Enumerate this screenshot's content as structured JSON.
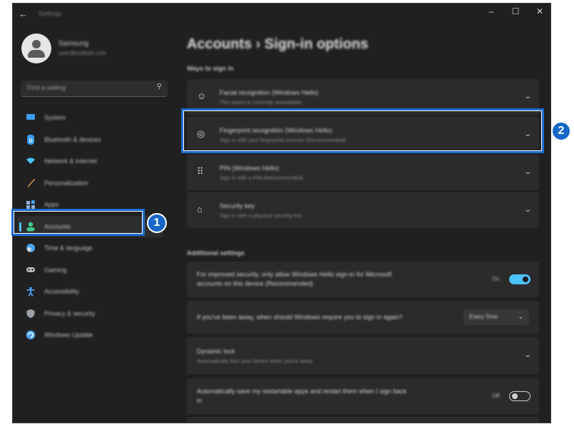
{
  "window": {
    "back_icon": "arrow-left-icon",
    "title": "Settings",
    "controls": [
      "–",
      "☐",
      "✕"
    ]
  },
  "profile": {
    "name": "Samsung",
    "email": "user@outlook.com"
  },
  "search": {
    "placeholder": "Find a setting",
    "icon": "search-icon"
  },
  "sidebar": {
    "items": [
      {
        "label": "System",
        "icon": "monitor-icon",
        "color": "#3a9ef5"
      },
      {
        "label": "Bluetooth & devices",
        "icon": "bluetooth-icon",
        "color": "#3a9ef5"
      },
      {
        "label": "Network & internet",
        "icon": "wifi-icon",
        "color": "#4cc2ff"
      },
      {
        "label": "Personalization",
        "icon": "brush-icon",
        "color": "#e6a15a"
      },
      {
        "label": "Apps",
        "icon": "apps-icon",
        "color": "#8fb0d8"
      },
      {
        "label": "Accounts",
        "icon": "person-icon",
        "color": "#3fc98a",
        "active": true
      },
      {
        "label": "Time & language",
        "icon": "globe-clock-icon",
        "color": "#4ba3f0"
      },
      {
        "label": "Gaming",
        "icon": "gamepad-icon",
        "color": "#bdbdbd"
      },
      {
        "label": "Accessibility",
        "icon": "accessibility-icon",
        "color": "#4ba3f0"
      },
      {
        "label": "Privacy & security",
        "icon": "shield-icon",
        "color": "#9aa0a8"
      },
      {
        "label": "Windows Update",
        "icon": "update-icon",
        "color": "#4ba3f0"
      }
    ]
  },
  "main": {
    "title": "Accounts  ›  Sign-in options",
    "ways_label": "Ways to sign in",
    "sign_in_options": [
      {
        "title": "Facial recognition (Windows Hello)",
        "subtitle": "This option is currently unavailable",
        "icon": "face-icon",
        "glyph": "☺"
      },
      {
        "title": "Fingerprint recognition (Windows Hello)",
        "subtitle": "Sign in with your fingerprint scanner (Recommended)",
        "icon": "fingerprint-icon",
        "glyph": "◎"
      },
      {
        "title": "PIN (Windows Hello)",
        "subtitle": "Sign in with a PIN (Recommended)",
        "icon": "keypad-icon",
        "glyph": "⠿"
      },
      {
        "title": "Security key",
        "subtitle": "Sign in with a physical security key",
        "icon": "usb-key-icon",
        "glyph": "⌂"
      }
    ],
    "additional_label": "Additional settings",
    "additional": {
      "hello_only": {
        "text_line1": "For improved security, only allow Windows Hello sign-in for Microsoft",
        "text_line2": "accounts on this device (Recommended)",
        "state": "On"
      },
      "away_time": {
        "text": "If you've been away, when should Windows require you to sign in again?",
        "value": "Every Time"
      },
      "dynamic_lock": {
        "title": "Dynamic lock",
        "subtitle": "Automatically lock your device when you're away"
      },
      "auto_save_apps": {
        "text_line1": "Automatically save my restartable apps and restart them when I sign back",
        "text_line2": "in",
        "state": "Off"
      }
    }
  },
  "callouts": {
    "one": "1",
    "two": "2"
  },
  "colors": {
    "accent": "#4cc2ff",
    "callout_blue": "#1667c7"
  }
}
